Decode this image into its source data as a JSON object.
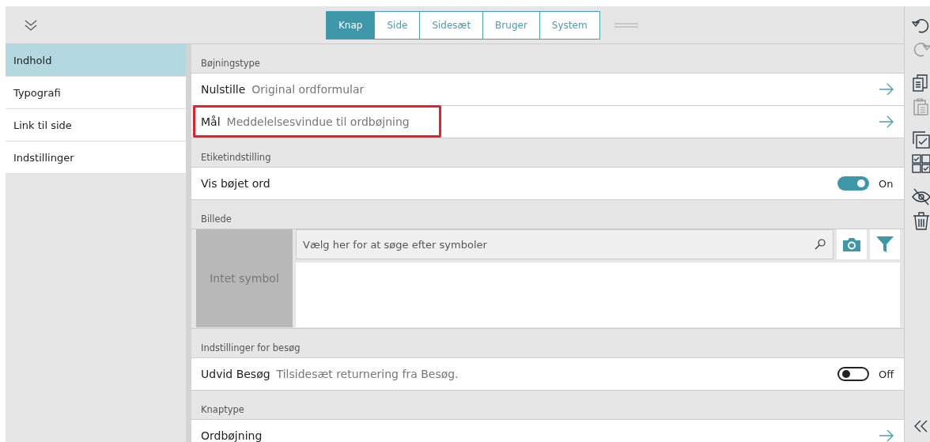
{
  "tabs": [
    {
      "label": "Knap",
      "selected": true
    },
    {
      "label": "Side",
      "selected": false
    },
    {
      "label": "Sidesæt",
      "selected": false
    },
    {
      "label": "Bruger",
      "selected": false
    },
    {
      "label": "System",
      "selected": false
    }
  ],
  "sidebar": {
    "items": [
      {
        "label": "Indhold",
        "selected": true
      },
      {
        "label": "Typografi",
        "selected": false
      },
      {
        "label": "Link til side",
        "selected": false
      },
      {
        "label": "Indstillinger",
        "selected": false
      }
    ]
  },
  "sections": [
    {
      "header": "Bøjningstype",
      "rows": [
        {
          "kind": "link",
          "title": "Nulstille",
          "detail": "Original ordformular",
          "highlighted": false
        },
        {
          "kind": "link",
          "title": "Mål",
          "detail": "Meddelelsesvindue til ordbøjning",
          "highlighted": true
        }
      ]
    },
    {
      "header": "Etiketindstilling",
      "rows": [
        {
          "kind": "toggle",
          "title": "Vis bøjet ord",
          "on": true,
          "state_label": "On"
        }
      ]
    },
    {
      "header": "Billede",
      "rows": [
        {
          "kind": "image",
          "symbol_label": "Intet symbol",
          "placeholder": "Vælg her for at søge efter symboler"
        }
      ]
    },
    {
      "header": "Indstillinger for besøg",
      "rows": [
        {
          "kind": "toggle",
          "title": "Udvid Besøg",
          "detail": "Tilsidesæt returnering fra Besøg.",
          "on": false,
          "state_label": "Off"
        }
      ]
    },
    {
      "header": "Knaptype",
      "rows": [
        {
          "kind": "link",
          "title": "Ordbøjning",
          "highlighted": false
        }
      ]
    }
  ],
  "toolbar": [
    {
      "kind": "undo",
      "disabled": false
    },
    {
      "kind": "redo",
      "disabled": true
    },
    {
      "kind": "gap"
    },
    {
      "kind": "copy",
      "disabled": false
    },
    {
      "kind": "paste",
      "disabled": true
    },
    {
      "kind": "gap"
    },
    {
      "kind": "select",
      "disabled": false
    },
    {
      "kind": "grid",
      "disabled": false
    },
    {
      "kind": "gap"
    },
    {
      "kind": "hide",
      "disabled": false
    },
    {
      "kind": "delete",
      "disabled": false
    }
  ]
}
